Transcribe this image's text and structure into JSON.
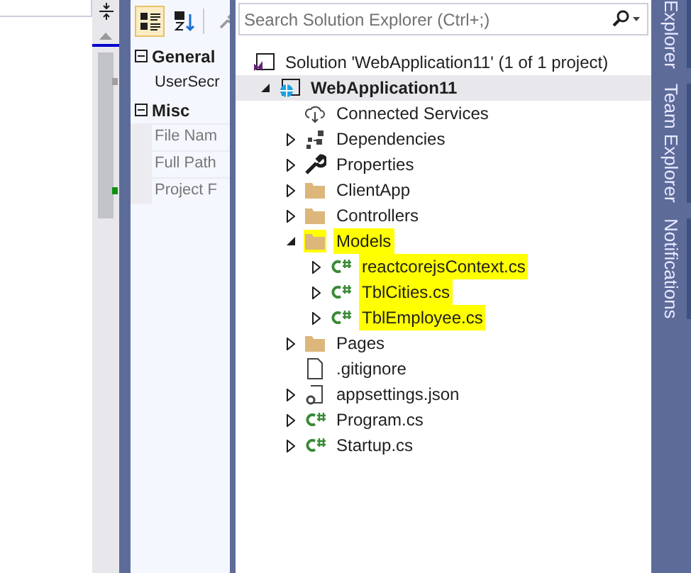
{
  "properties": {
    "toolbar": [
      {
        "kind": "categorized",
        "selected": true
      },
      {
        "kind": "alphabetical",
        "selected": false
      },
      {
        "kind": "wrench",
        "selected": false
      }
    ],
    "categories": [
      {
        "name": "General",
        "expanded": true,
        "items": [
          "UserSecr"
        ]
      },
      {
        "name": "Misc",
        "expanded": true,
        "items": [
          "File Nam",
          "Full Path",
          "Project F"
        ]
      }
    ]
  },
  "solution_explorer": {
    "search": {
      "placeholder": "Search Solution Explorer (Ctrl+;)"
    },
    "tree": [
      {
        "label": "Solution 'WebApplication11' (1 of 1 project)",
        "kind": "solution",
        "selected": false,
        "highlighted": false,
        "bold": false,
        "children": [
          {
            "label": "WebApplication11",
            "kind": "project",
            "expanded": true,
            "selected": true,
            "highlighted": false,
            "bold": true,
            "children": [
              {
                "label": "Connected Services",
                "kind": "cloud",
                "selected": false,
                "highlighted": false,
                "bold": false
              },
              {
                "label": "Dependencies",
                "kind": "dependencies",
                "expanded": false,
                "selected": false,
                "highlighted": false,
                "bold": false
              },
              {
                "label": "Properties",
                "kind": "wrench",
                "expanded": false,
                "selected": false,
                "highlighted": false,
                "bold": false
              },
              {
                "label": "ClientApp",
                "kind": "folder",
                "expanded": false,
                "selected": false,
                "highlighted": false,
                "bold": false
              },
              {
                "label": "Controllers",
                "kind": "folder",
                "expanded": false,
                "selected": false,
                "highlighted": false,
                "bold": false
              },
              {
                "label": "Models",
                "kind": "folder",
                "expanded": true,
                "selected": false,
                "highlighted": true,
                "bold": false,
                "children": [
                  {
                    "label": "reactcorejsContext.cs",
                    "kind": "csharp",
                    "expanded": false,
                    "selected": false,
                    "highlighted": true,
                    "bold": false
                  },
                  {
                    "label": "TblCities.cs",
                    "kind": "csharp",
                    "expanded": false,
                    "selected": false,
                    "highlighted": true,
                    "bold": false
                  },
                  {
                    "label": "TblEmployee.cs",
                    "kind": "csharp",
                    "expanded": false,
                    "selected": false,
                    "highlighted": true,
                    "bold": false
                  }
                ]
              },
              {
                "label": "Pages",
                "kind": "folder",
                "expanded": false,
                "selected": false,
                "highlighted": false,
                "bold": false
              },
              {
                "label": ".gitignore",
                "kind": "file",
                "selected": false,
                "highlighted": false,
                "bold": false
              },
              {
                "label": "appsettings.json",
                "kind": "json",
                "expanded": false,
                "selected": false,
                "highlighted": false,
                "bold": false
              },
              {
                "label": "Program.cs",
                "kind": "csharp",
                "expanded": false,
                "selected": false,
                "highlighted": false,
                "bold": false
              },
              {
                "label": "Startup.cs",
                "kind": "csharp",
                "expanded": false,
                "selected": false,
                "highlighted": false,
                "bold": false
              }
            ]
          }
        ]
      }
    ]
  },
  "side_tabs": [
    "Explorer",
    "Team Explorer",
    "Notifications"
  ]
}
